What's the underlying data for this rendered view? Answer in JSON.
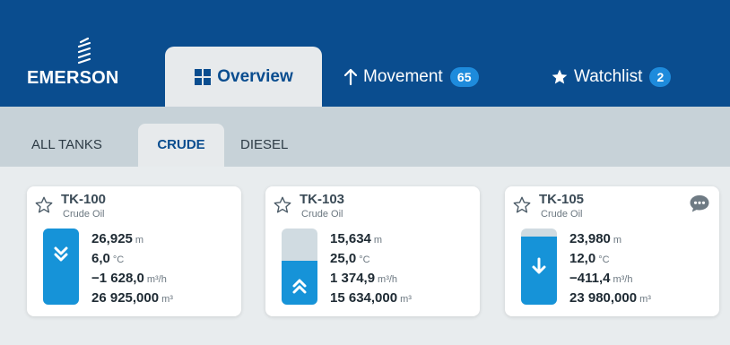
{
  "brand": {
    "name": "EMERSON"
  },
  "main_tabs": [
    {
      "label": "Overview",
      "icon": "grid-icon",
      "active": true
    },
    {
      "label": "Movement",
      "icon": "arrow-up-icon",
      "badge": "65"
    },
    {
      "label": "Watchlist",
      "icon": "star-icon",
      "badge": "2"
    }
  ],
  "sub_tabs": [
    {
      "label": "ALL TANKS"
    },
    {
      "label": "CRUDE",
      "active": true
    },
    {
      "label": "DIESEL"
    }
  ],
  "tanks": [
    {
      "name": "TK-100",
      "product": "Crude Oil",
      "level": "26,925",
      "level_unit": "m",
      "temp": "6,0",
      "temp_unit": "°C",
      "flow": "−1 628,0",
      "flow_unit": "m³/h",
      "volume": "26 925,000",
      "volume_unit": "m³",
      "direction": "down",
      "fill_fraction": 1.0,
      "has_comment": false
    },
    {
      "name": "TK-103",
      "product": "Crude Oil",
      "level": "15,634",
      "level_unit": "m",
      "temp": "25,0",
      "temp_unit": "°C",
      "flow": "1 374,9",
      "flow_unit": "m³/h",
      "volume": "15 634,000",
      "volume_unit": "m³",
      "direction": "up",
      "fill_fraction": 0.58,
      "has_comment": false
    },
    {
      "name": "TK-105",
      "product": "Crude Oil",
      "level": "23,980",
      "level_unit": "m",
      "temp": "12,0",
      "temp_unit": "°C",
      "flow": "−411,4",
      "flow_unit": "m³/h",
      "volume": "23 980,000",
      "volume_unit": "m³",
      "direction": "down",
      "fill_fraction": 0.89,
      "has_comment": true
    }
  ],
  "colors": {
    "header": "#0a4d8f",
    "accent": "#1693d8",
    "band": "#c7d2d8"
  }
}
